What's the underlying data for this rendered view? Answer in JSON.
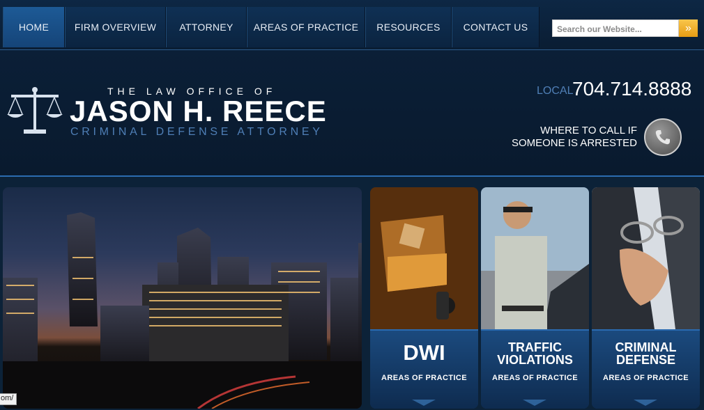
{
  "nav": {
    "items": [
      {
        "label": "HOME"
      },
      {
        "label": "FIRM OVERVIEW"
      },
      {
        "label": "ATTORNEY"
      },
      {
        "label": "AREAS OF PRACTICE"
      },
      {
        "label": "RESOURCES"
      },
      {
        "label": "CONTACT US"
      }
    ],
    "search": {
      "placeholder": "Search our Website...",
      "button": "»"
    }
  },
  "header": {
    "logo": {
      "top": "THE LAW OFFICE OF",
      "name": "JASON H. REECE",
      "subtitle": "CRIMINAL DEFENSE ATTORNEY"
    },
    "phone_label": "LOCAL",
    "phone": "704.714.8888",
    "call_line1": "WHERE TO CALL IF",
    "call_line2": "SOMEONE IS ARRESTED"
  },
  "tiles": [
    {
      "title_line1": "DWI",
      "title_line2": "",
      "sub": "AREAS OF PRACTICE"
    },
    {
      "title_line1": "TRAFFIC",
      "title_line2": "VIOLATIONS",
      "sub": "AREAS OF PRACTICE"
    },
    {
      "title_line1": "CRIMINAL",
      "title_line2": "DEFENSE",
      "sub": "AREAS OF PRACTICE"
    }
  ],
  "status_bar": {
    "url_fragment": "om/"
  },
  "colors": {
    "accent": "#2b6cb0",
    "nav_bg": "#0d2744",
    "search_btn": "#f0a820"
  }
}
